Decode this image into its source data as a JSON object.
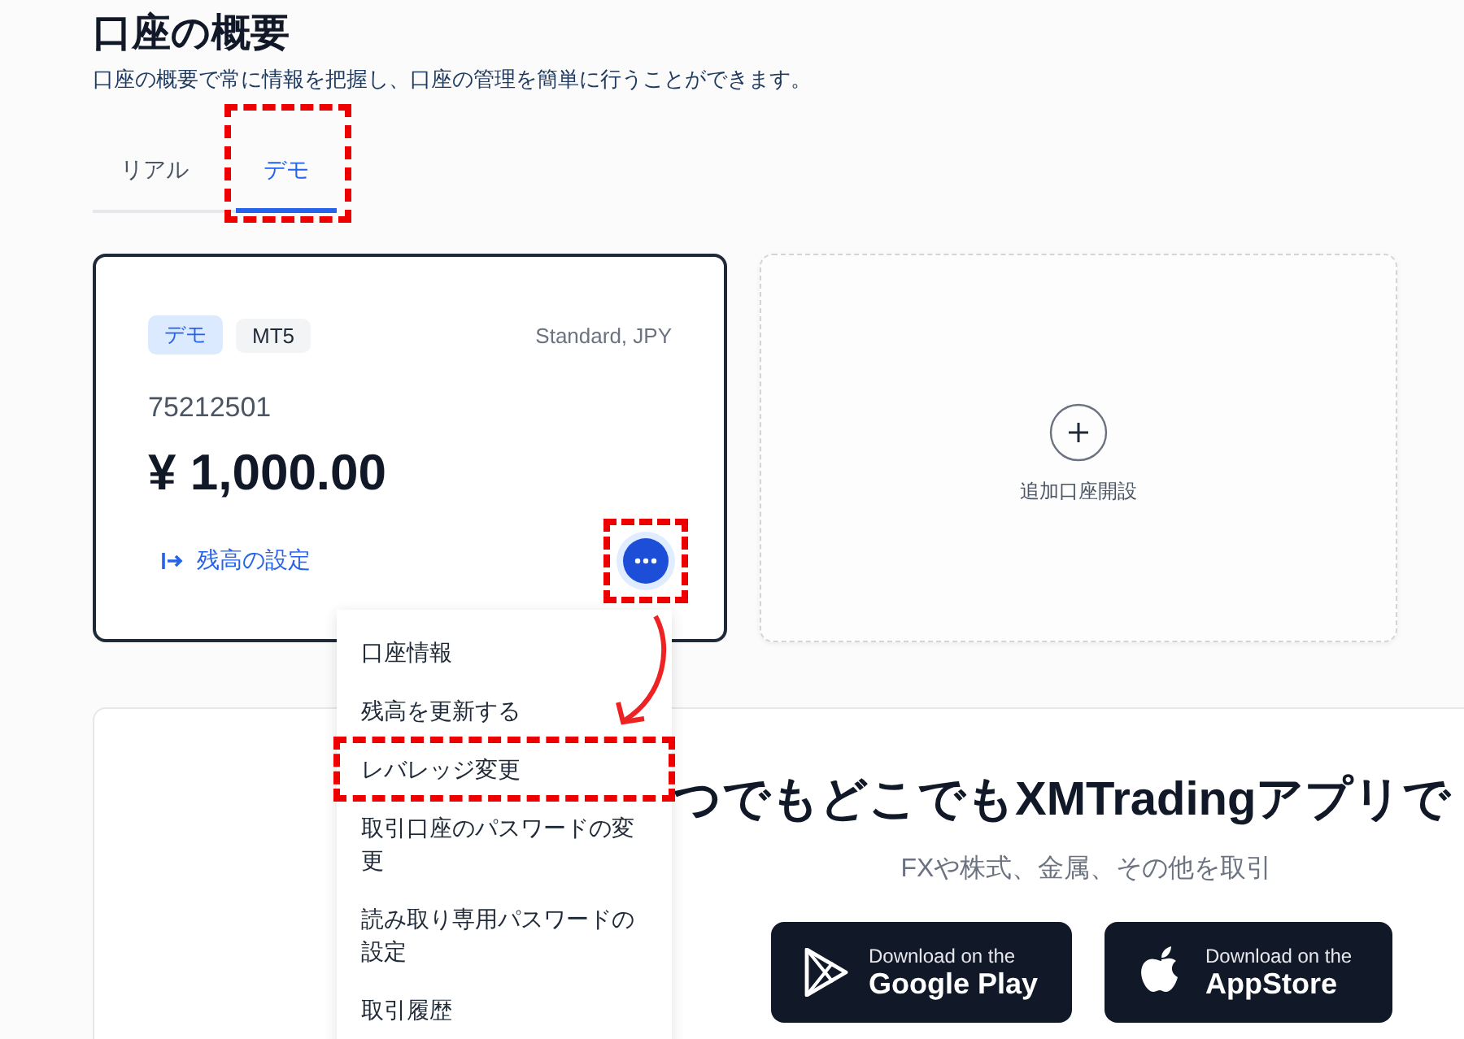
{
  "page": {
    "title": "口座の概要",
    "subtitle": "口座の概要で常に情報を把握し、口座の管理を簡単に行うことができます。"
  },
  "tabs": [
    {
      "label": "リアル",
      "selected": false,
      "highlighted": false
    },
    {
      "label": "デモ",
      "selected": true,
      "highlighted": true
    }
  ],
  "account_card": {
    "tags": [
      {
        "label": "デモ",
        "kind": "type"
      },
      {
        "label": "MT5",
        "kind": "platform"
      }
    ],
    "account_type": "Standard, JPY",
    "account_number": "75212501",
    "balance": "¥ 1,000.00",
    "set_balance_link": "残高の設定",
    "more_button_highlighted": true
  },
  "add_account": {
    "label": "追加口座開設"
  },
  "menu": {
    "callout_arrow": true,
    "items": [
      {
        "label": "口座情報",
        "highlighted": false
      },
      {
        "label": "残高を更新する",
        "highlighted": false
      },
      {
        "label": "レバレッジ変更",
        "highlighted": true
      },
      {
        "label": "取引口座のパスワードの変更",
        "highlighted": false
      },
      {
        "label": "読み取り専用パスワードの設定",
        "highlighted": false
      },
      {
        "label": "取引履歴",
        "highlighted": false
      }
    ]
  },
  "promo": {
    "heading": "つでもどこでもXMTradingアプリで",
    "subtitle": "FXや株式、金属、その他を取引",
    "buttons": [
      {
        "kind": "google_play",
        "caption": "Download on the",
        "label": "Google Play"
      },
      {
        "kind": "app_store",
        "caption": "Download on the",
        "label": "AppStore"
      }
    ]
  }
}
